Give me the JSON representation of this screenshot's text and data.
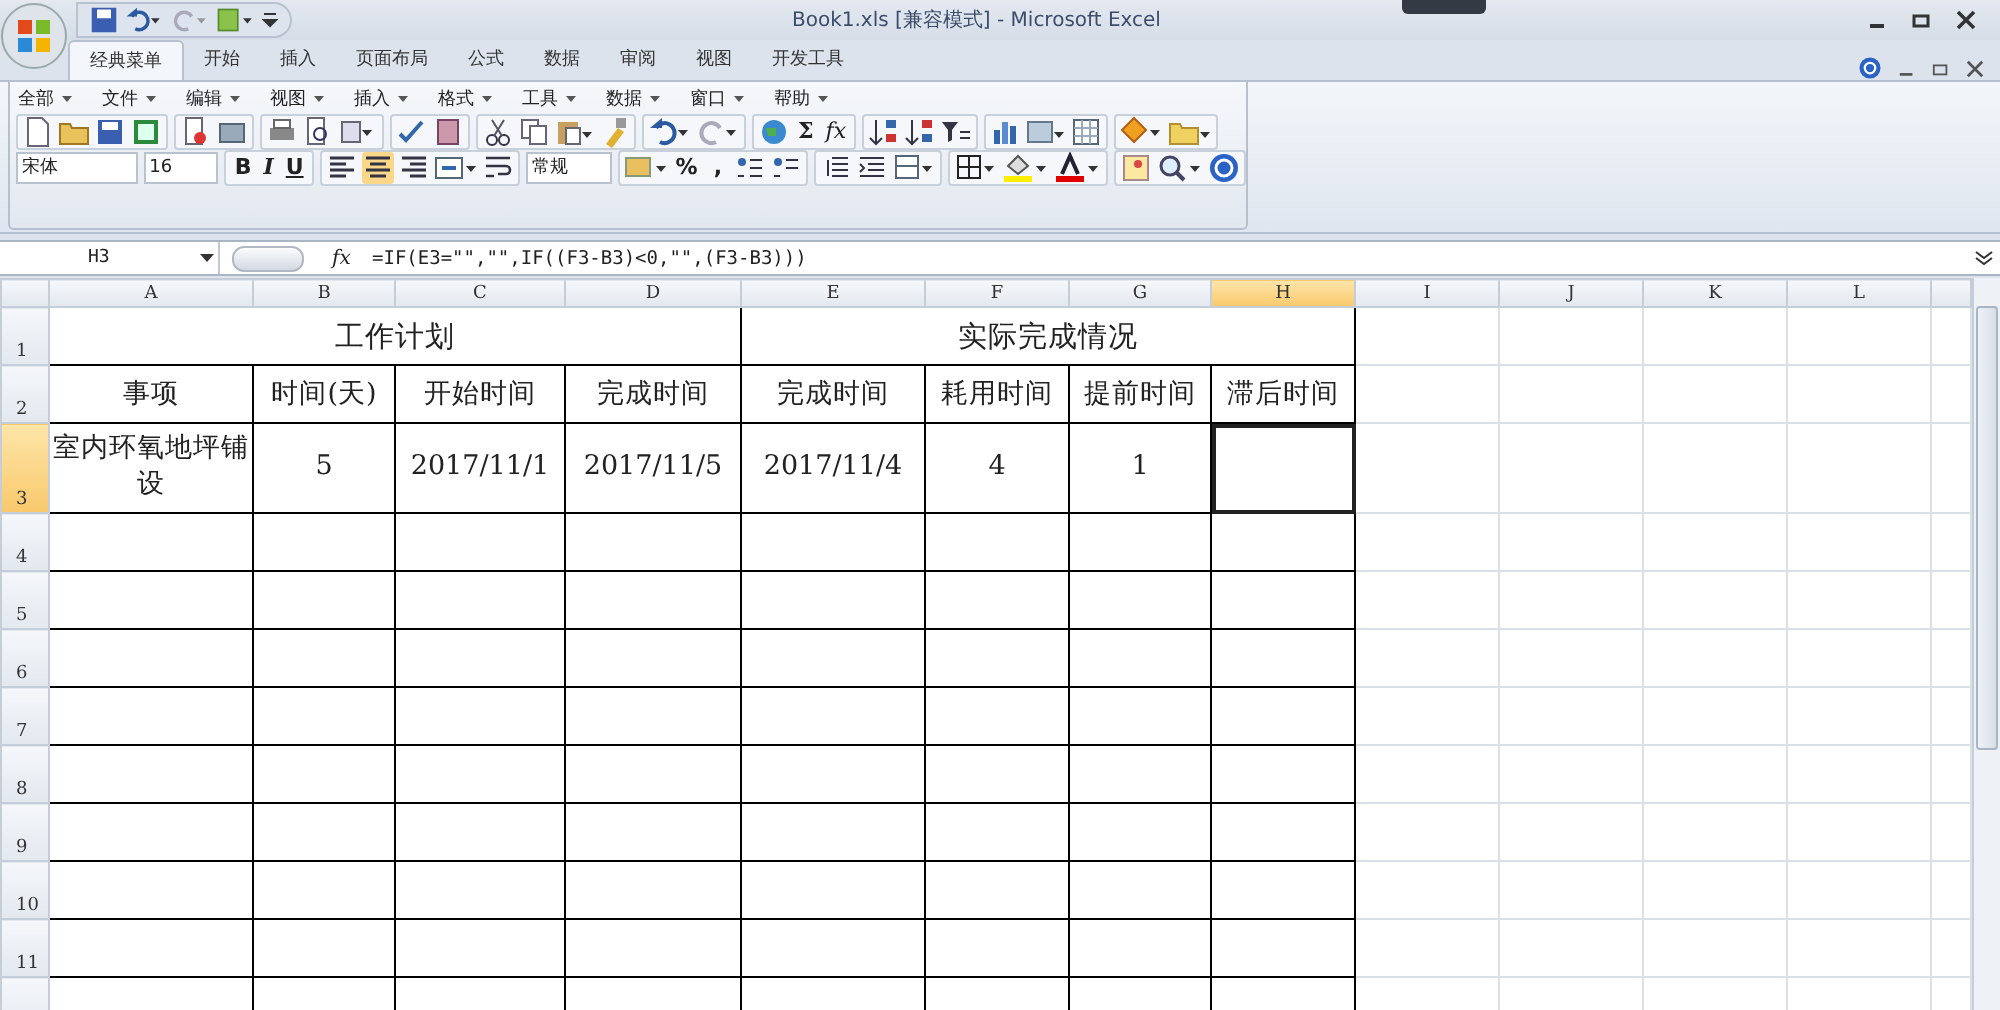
{
  "window": {
    "title": "Book1.xls  [兼容模式]  -  Microsoft Excel"
  },
  "ribbon_tabs": [
    {
      "label": "经典菜单",
      "selected": true
    },
    {
      "label": "开始",
      "selected": false
    },
    {
      "label": "插入",
      "selected": false
    },
    {
      "label": "页面布局",
      "selected": false
    },
    {
      "label": "公式",
      "selected": false
    },
    {
      "label": "数据",
      "selected": false
    },
    {
      "label": "审阅",
      "selected": false
    },
    {
      "label": "视图",
      "selected": false
    },
    {
      "label": "开发工具",
      "selected": false
    }
  ],
  "menus": [
    "全部",
    "文件",
    "编辑",
    "视图",
    "插入",
    "格式",
    "工具",
    "数据",
    "窗口",
    "帮助"
  ],
  "toolbar": {
    "sum": "Σ",
    "function": "fx",
    "font": "宋体",
    "font_size": "16",
    "styles": [
      "B",
      "I",
      "U"
    ],
    "alignments": [
      {
        "selected": false
      },
      {
        "selected": true
      },
      {
        "selected": false
      }
    ],
    "number_format": "常规",
    "percent": "%",
    "comma": ","
  },
  "formula_bar": {
    "name_box": "H3",
    "fx": "fx",
    "formula": "=IF(E3=\"\",\"\",IF((F3-B3)<0,\"\",(F3-B3)))"
  },
  "sheet": {
    "columns": [
      {
        "label": "A",
        "selected": false
      },
      {
        "label": "B",
        "selected": false
      },
      {
        "label": "C",
        "selected": false
      },
      {
        "label": "D",
        "selected": false
      },
      {
        "label": "E",
        "selected": false
      },
      {
        "label": "F",
        "selected": false
      },
      {
        "label": "G",
        "selected": false
      },
      {
        "label": "H",
        "selected": true
      },
      {
        "label": "I",
        "selected": false
      },
      {
        "label": "J",
        "selected": false
      },
      {
        "label": "K",
        "selected": false
      },
      {
        "label": "L",
        "selected": false
      }
    ],
    "rows": [
      {
        "number": "1",
        "selected": false,
        "cells": [
          {
            "text": "工作计划",
            "kind": "group",
            "selected": false
          },
          {
            "text": "实际完成情况",
            "kind": "group",
            "selected": false
          }
        ]
      },
      {
        "number": "2",
        "selected": false,
        "cells": [
          {
            "text": "事项",
            "selected": false
          },
          {
            "text": "时间(天)",
            "selected": false
          },
          {
            "text": "开始时间",
            "selected": false
          },
          {
            "text": "完成时间",
            "selected": false
          },
          {
            "text": "完成时间",
            "selected": false
          },
          {
            "text": "耗用时间",
            "selected": false
          },
          {
            "text": "提前时间",
            "selected": false
          },
          {
            "text": "滞后时间",
            "selected": false
          }
        ]
      },
      {
        "number": "3",
        "selected": true,
        "cells": [
          {
            "text": "室内环氧地坪铺设",
            "selected": false
          },
          {
            "text": "5",
            "selected": false
          },
          {
            "text": "2017/11/1",
            "selected": false
          },
          {
            "text": "2017/11/5",
            "selected": false
          },
          {
            "text": "2017/11/4",
            "selected": false
          },
          {
            "text": "4",
            "selected": false
          },
          {
            "text": "1",
            "selected": false
          },
          {
            "selected": true
          }
        ]
      },
      {
        "number": "4",
        "selected": false
      },
      {
        "number": "5",
        "selected": false
      },
      {
        "number": "6",
        "selected": false
      },
      {
        "number": "7",
        "selected": false
      },
      {
        "number": "8",
        "selected": false
      },
      {
        "number": "9",
        "selected": false
      },
      {
        "number": "10",
        "selected": false
      },
      {
        "number": "11",
        "selected": false
      }
    ]
  }
}
